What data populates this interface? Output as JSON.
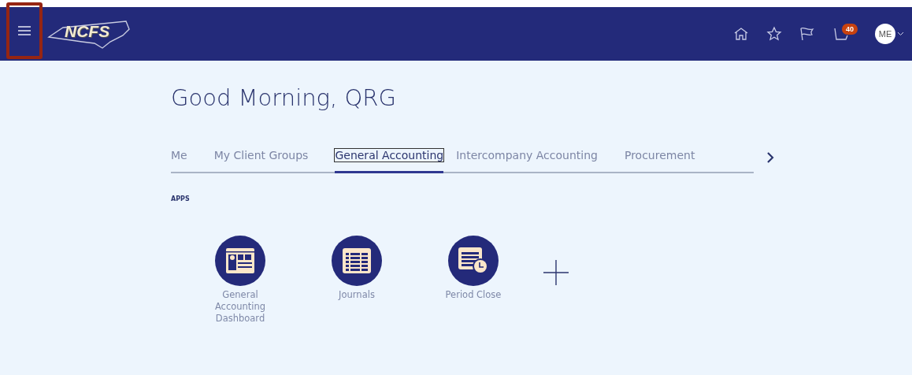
{
  "header": {
    "logo": "NCFS",
    "notifications_badge": "40",
    "avatar": "ME"
  },
  "greeting": "Good Morning, QRG",
  "tabs": [
    {
      "label": "Me",
      "selected": false
    },
    {
      "label": "My Client Groups",
      "selected": false
    },
    {
      "label": "General Accounting",
      "selected": true
    },
    {
      "label": "Intercompany Accounting",
      "selected": false
    },
    {
      "label": "Procurement",
      "selected": false
    }
  ],
  "section_title": "APPS",
  "apps": [
    {
      "kind": "dashboard",
      "label": "General Accounting Dashboard"
    },
    {
      "kind": "table",
      "label": "Journals"
    },
    {
      "kind": "clock",
      "label": "Period Close"
    }
  ]
}
